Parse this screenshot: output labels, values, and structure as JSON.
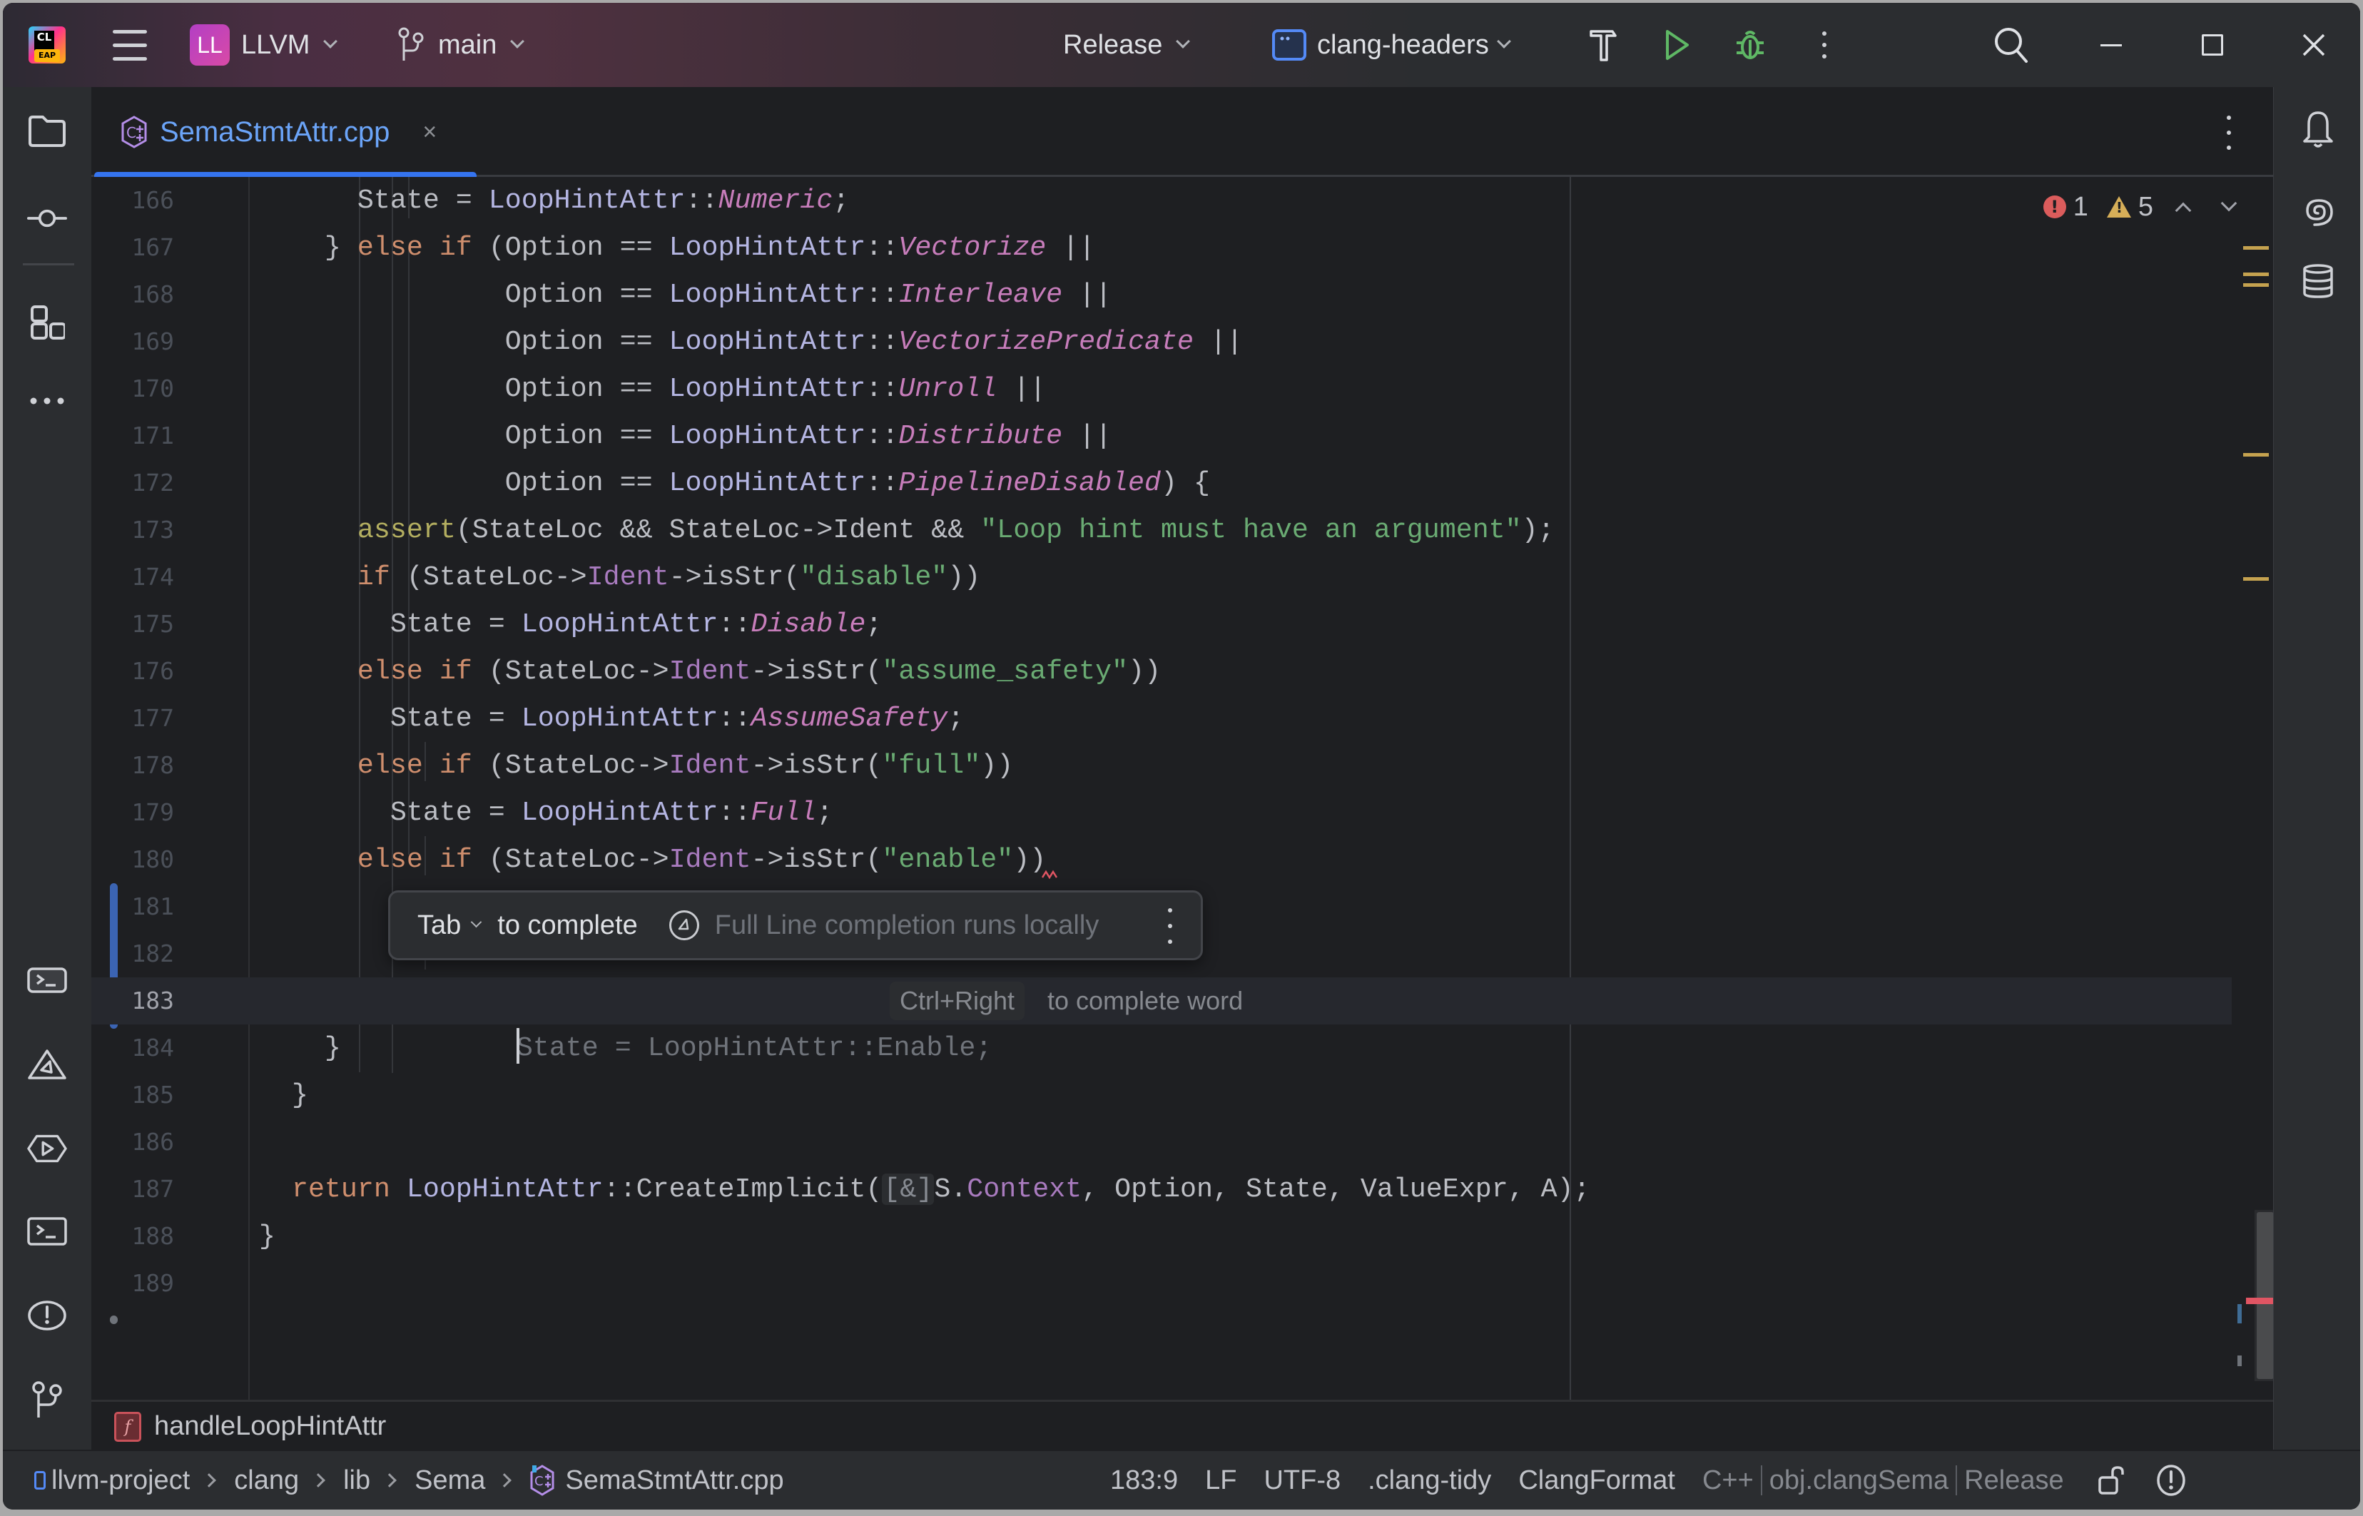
{
  "titlebar": {
    "project_initials": "LL",
    "project_name": "LLVM",
    "branch": "main",
    "build_config": "Release",
    "run_target": "clang-headers"
  },
  "tab": {
    "file_name": "SemaStmtAttr.cpp",
    "close_glyph": "×"
  },
  "inspection": {
    "errors": "1",
    "warnings": "5"
  },
  "editor": {
    "current_line": 183,
    "lines": [
      {
        "n": "166"
      },
      {
        "n": "167"
      },
      {
        "n": "168"
      },
      {
        "n": "169"
      },
      {
        "n": "170"
      },
      {
        "n": "171"
      },
      {
        "n": "172"
      },
      {
        "n": "173"
      },
      {
        "n": "174"
      },
      {
        "n": "175"
      },
      {
        "n": "176"
      },
      {
        "n": "177"
      },
      {
        "n": "178"
      },
      {
        "n": "179"
      },
      {
        "n": "180"
      },
      {
        "n": "181"
      },
      {
        "n": "182"
      },
      {
        "n": "183"
      },
      {
        "n": "184"
      },
      {
        "n": "185"
      },
      {
        "n": "186"
      },
      {
        "n": "187"
      },
      {
        "n": "188"
      },
      {
        "n": "189"
      }
    ],
    "code": {
      "l166": [
        "      State = ",
        "LoopHintAttr",
        "::",
        "Numeric",
        ";"
      ],
      "l167": [
        "    } ",
        "else if",
        " (Option == ",
        "LoopHintAttr",
        "::",
        "Vectorize",
        " ||"
      ],
      "l168": [
        "               Option == ",
        "LoopHintAttr",
        "::",
        "Interleave",
        " ||"
      ],
      "l169": [
        "               Option == ",
        "LoopHintAttr",
        "::",
        "VectorizePredicate",
        " ||"
      ],
      "l170": [
        "               Option == ",
        "LoopHintAttr",
        "::",
        "Unroll",
        " ||"
      ],
      "l171": [
        "               Option == ",
        "LoopHintAttr",
        "::",
        "Distribute",
        " ||"
      ],
      "l172": [
        "               Option == ",
        "LoopHintAttr",
        "::",
        "PipelineDisabled",
        ") {"
      ],
      "l173": [
        "      ",
        "assert",
        "(StateLoc && StateLoc->Ident && ",
        "\"Loop hint must have an argument\"",
        ");"
      ],
      "l174": [
        "      ",
        "if",
        " (StateLoc->",
        "Ident",
        "->isStr(",
        "\"disable\"",
        "))"
      ],
      "l175": [
        "        State = ",
        "LoopHintAttr",
        "::",
        "Disable",
        ";"
      ],
      "l176": [
        "      ",
        "else if",
        " (StateLoc->",
        "Ident",
        "->isStr(",
        "\"assume_safety\"",
        "))"
      ],
      "l177": [
        "        State = ",
        "LoopHintAttr",
        "::",
        "AssumeSafety",
        ";"
      ],
      "l178": [
        "      ",
        "else if",
        " (StateLoc->",
        "Ident",
        "->isStr(",
        "\"full\"",
        "))"
      ],
      "l179": [
        "        State = ",
        "LoopHintAttr",
        "::",
        "Full",
        ";"
      ],
      "l180": [
        "      ",
        "else if",
        " (StateLoc->",
        "Ident",
        "->isStr(",
        "\"enable\"",
        "))"
      ],
      "l183_ghost": "State = LoopHintAttr::Enable;",
      "l184": "    }",
      "l185": "  }",
      "l187": [
        "  ",
        "return",
        " ",
        "LoopHintAttr",
        "::CreateImplicit(",
        "[&]",
        "S.",
        "Context",
        ", Option, State, ValueExpr, A);"
      ],
      "l188": "}"
    },
    "inline_hint": {
      "shortcut": "Ctrl+Right",
      "text": "to complete word"
    }
  },
  "completion_popup": {
    "key": "Tab",
    "action": "to complete",
    "info": "Full Line completion runs locally"
  },
  "breadcrumb_function": "handleLoopHintAttr",
  "statusbar": {
    "path": [
      "llvm-project",
      "clang",
      "lib",
      "Sema",
      "SemaStmtAttr.cpp"
    ],
    "position": "183:9",
    "line_ending": "LF",
    "encoding": "UTF-8",
    "linter": ".clang-tidy",
    "formatter": "ClangFormat",
    "language": "C++",
    "resolve_context": "obj.clangSema",
    "config": "Release"
  },
  "colors": {
    "accent": "#3574f0",
    "keyword": "#cf8e6d",
    "class": "#b5b6e3",
    "enum_constant": "#c77dbb",
    "string": "#6aab73",
    "error": "#db5c5c",
    "warning": "#d6ae58"
  }
}
